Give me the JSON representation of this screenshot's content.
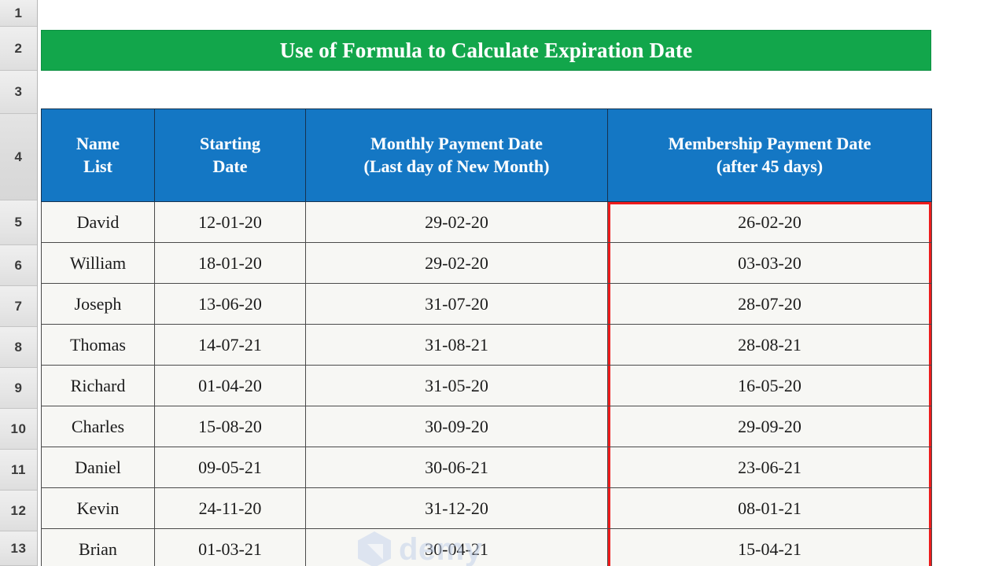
{
  "app": {
    "type": "spreadsheet",
    "colors": {
      "title_banner_bg": "#12a64b",
      "title_banner_text": "#ffffff",
      "table_header_bg": "#1477c4",
      "table_header_text": "#ffffff",
      "cell_bg": "#f7f7f4",
      "cell_text": "#1b1b1b",
      "highlight_border": "#ee1c1c",
      "gutter_bg": "#e6e6e6"
    }
  },
  "row_headers": [
    {
      "label": "1",
      "height": 34
    },
    {
      "label": "2",
      "height": 56
    },
    {
      "label": "3",
      "height": 55
    },
    {
      "label": "4",
      "height": 110
    },
    {
      "label": "5",
      "height": 57
    },
    {
      "label": "6",
      "height": 52
    },
    {
      "label": "7",
      "height": 52
    },
    {
      "label": "8",
      "height": 52
    },
    {
      "label": "9",
      "height": 52
    },
    {
      "label": "10",
      "height": 52
    },
    {
      "label": "11",
      "height": 52
    },
    {
      "label": "12",
      "height": 52
    },
    {
      "label": "13",
      "height": 44
    }
  ],
  "title": {
    "text": "Use of Formula to Calculate Expiration Date"
  },
  "table": {
    "headers": [
      {
        "line1": "Name",
        "line2": "List"
      },
      {
        "line1": "Starting",
        "line2": "Date"
      },
      {
        "line1": "Monthly Payment Date",
        "line2": "(Last day of New Month)"
      },
      {
        "line1": "Membership Payment Date",
        "line2": "(after 45 days)"
      }
    ],
    "highlighted_column_index": 3,
    "rows": [
      {
        "name": "David",
        "starting_date": "12-01-20",
        "monthly_payment_date": "29-02-20",
        "membership_payment_date": "26-02-20"
      },
      {
        "name": "William",
        "starting_date": "18-01-20",
        "monthly_payment_date": "29-02-20",
        "membership_payment_date": "03-03-20"
      },
      {
        "name": "Joseph",
        "starting_date": "13-06-20",
        "monthly_payment_date": "31-07-20",
        "membership_payment_date": "28-07-20"
      },
      {
        "name": "Thomas",
        "starting_date": "14-07-21",
        "monthly_payment_date": "31-08-21",
        "membership_payment_date": "28-08-21"
      },
      {
        "name": "Richard",
        "starting_date": "01-04-20",
        "monthly_payment_date": "31-05-20",
        "membership_payment_date": "16-05-20"
      },
      {
        "name": "Charles",
        "starting_date": "15-08-20",
        "monthly_payment_date": "30-09-20",
        "membership_payment_date": "29-09-20"
      },
      {
        "name": "Daniel",
        "starting_date": "09-05-21",
        "monthly_payment_date": "30-06-21",
        "membership_payment_date": "23-06-21"
      },
      {
        "name": "Kevin",
        "starting_date": "24-11-20",
        "monthly_payment_date": "31-12-20",
        "membership_payment_date": "08-01-21"
      },
      {
        "name": "Brian",
        "starting_date": "01-03-21",
        "monthly_payment_date": "30-04-21",
        "membership_payment_date": "15-04-21"
      }
    ]
  },
  "watermark": {
    "text": "demy",
    "logo": "hexagon-logo-icon"
  }
}
